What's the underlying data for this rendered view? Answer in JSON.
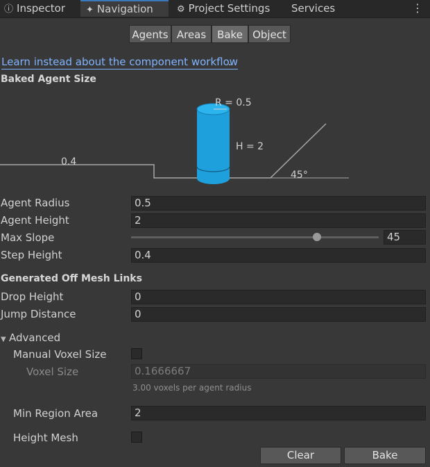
{
  "tabs": [
    {
      "label": "Inspector",
      "icon": "info-icon"
    },
    {
      "label": "Navigation",
      "icon": "navigation-icon"
    },
    {
      "label": "Project Settings",
      "icon": "gear-icon"
    },
    {
      "label": "Services"
    }
  ],
  "subtabs": [
    "Agents",
    "Areas",
    "Bake",
    "Object"
  ],
  "active_subtab": "Bake",
  "link_text": "Learn instead about the component workflow",
  "link_suffix": ".",
  "baked_agent_size": {
    "title": "Baked Agent Size",
    "diagram": {
      "radius_label": "R = 0.5",
      "height_label": "H = 2",
      "step_label": "0.4",
      "slope_label": "45°"
    },
    "agent_radius": {
      "label": "Agent Radius",
      "value": "0.5"
    },
    "agent_height": {
      "label": "Agent Height",
      "value": "2"
    },
    "max_slope": {
      "label": "Max Slope",
      "value": "45",
      "min": 0,
      "max": 60
    },
    "step_height": {
      "label": "Step Height",
      "value": "0.4"
    }
  },
  "off_mesh": {
    "title": "Generated Off Mesh Links",
    "drop_height": {
      "label": "Drop Height",
      "value": "0"
    },
    "jump_distance": {
      "label": "Jump Distance",
      "value": "0"
    }
  },
  "advanced": {
    "title": "Advanced",
    "manual_voxel_size": {
      "label": "Manual Voxel Size",
      "checked": false
    },
    "voxel_size": {
      "label": "Voxel Size",
      "value": "0.1666667"
    },
    "voxel_hint": "3.00 voxels per agent radius",
    "min_region_area": {
      "label": "Min Region Area",
      "value": "2"
    },
    "height_mesh": {
      "label": "Height Mesh",
      "checked": false
    }
  },
  "buttons": {
    "clear": "Clear",
    "bake": "Bake"
  },
  "colors": {
    "accent": "#3a79bb",
    "agent_cylinder": "#1ea0dc",
    "link": "#81b4ff"
  }
}
